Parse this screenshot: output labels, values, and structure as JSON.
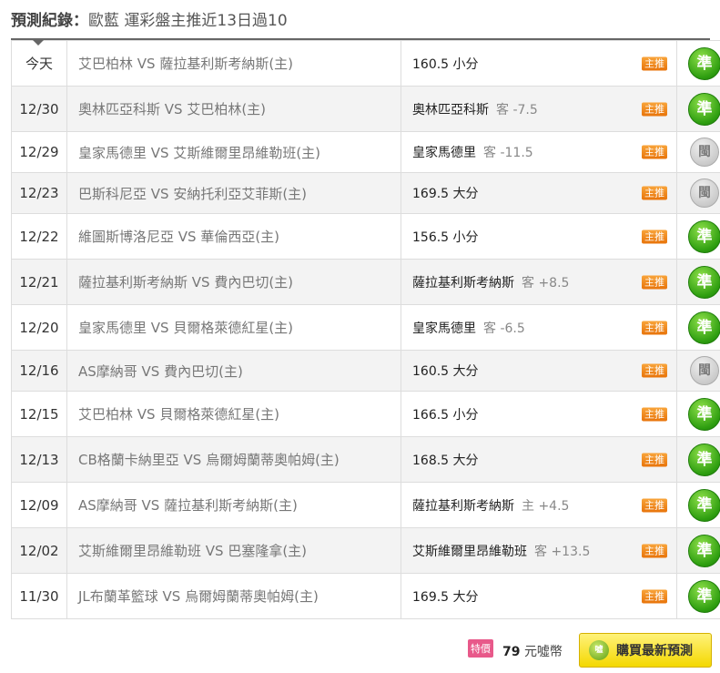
{
  "header": {
    "title_strong": "預測紀錄：",
    "title_rest": "歐藍 運彩盤主推近13日過10"
  },
  "records": [
    {
      "date": "今天",
      "match": "艾巴柏林 VS 薩拉基利斯考納斯(主)",
      "pick": "160.5 小分",
      "line": "",
      "tag": "主推",
      "result": "準"
    },
    {
      "date": "12/30",
      "match": "奧林匹亞科斯 VS 艾巴柏林(主)",
      "pick": "奧林匹亞科斯",
      "line": "客 -7.5",
      "tag": "主推",
      "result": "準"
    },
    {
      "date": "12/29",
      "match": "皇家馬德里 VS 艾斯維爾里昂維勒班(主)",
      "pick": "皇家馬德里",
      "line": "客 -11.5",
      "tag": "主推",
      "result": "閩"
    },
    {
      "date": "12/23",
      "match": "巴斯科尼亞 VS 安納托利亞艾菲斯(主)",
      "pick": "169.5 大分",
      "line": "",
      "tag": "主推",
      "result": "閩"
    },
    {
      "date": "12/22",
      "match": "維圖斯博洛尼亞 VS 華倫西亞(主)",
      "pick": "156.5 小分",
      "line": "",
      "tag": "主推",
      "result": "準"
    },
    {
      "date": "12/21",
      "match": "薩拉基利斯考納斯 VS 費內巴切(主)",
      "pick": "薩拉基利斯考納斯",
      "line": "客 +8.5",
      "tag": "主推",
      "result": "準"
    },
    {
      "date": "12/20",
      "match": "皇家馬德里 VS 貝爾格萊德紅星(主)",
      "pick": "皇家馬德里",
      "line": "客 -6.5",
      "tag": "主推",
      "result": "準"
    },
    {
      "date": "12/16",
      "match": "AS摩納哥 VS 費內巴切(主)",
      "pick": "160.5 大分",
      "line": "",
      "tag": "主推",
      "result": "閩"
    },
    {
      "date": "12/15",
      "match": "艾巴柏林 VS 貝爾格萊德紅星(主)",
      "pick": "166.5 小分",
      "line": "",
      "tag": "主推",
      "result": "準"
    },
    {
      "date": "12/13",
      "match": "CB格蘭卡納里亞 VS 烏爾姆蘭蒂奧帕姆(主)",
      "pick": "168.5 大分",
      "line": "",
      "tag": "主推",
      "result": "準"
    },
    {
      "date": "12/09",
      "match": "AS摩納哥 VS 薩拉基利斯考納斯(主)",
      "pick": "薩拉基利斯考納斯",
      "line": "主 +4.5",
      "tag": "主推",
      "result": "準"
    },
    {
      "date": "12/02",
      "match": "艾斯維爾里昂維勒班 VS 巴塞隆拿(主)",
      "pick": "艾斯維爾里昂維勒班",
      "line": "客 +13.5",
      "tag": "主推",
      "result": "準"
    },
    {
      "date": "11/30",
      "match": "JL布蘭革籃球 VS 烏爾姆蘭蒂奧帕姆(主)",
      "pick": "169.5 大分",
      "line": "",
      "tag": "主推",
      "result": "準"
    }
  ],
  "footer": {
    "special_tag": "特價",
    "price_num": "79",
    "price_unit": "元噓幣",
    "buy_label": "購買最新預測",
    "coin_text": "噓"
  },
  "colors": {
    "accent_green": "#2e9e10",
    "tag_orange": "#e8740a",
    "buy_yellow": "#f4d800"
  }
}
